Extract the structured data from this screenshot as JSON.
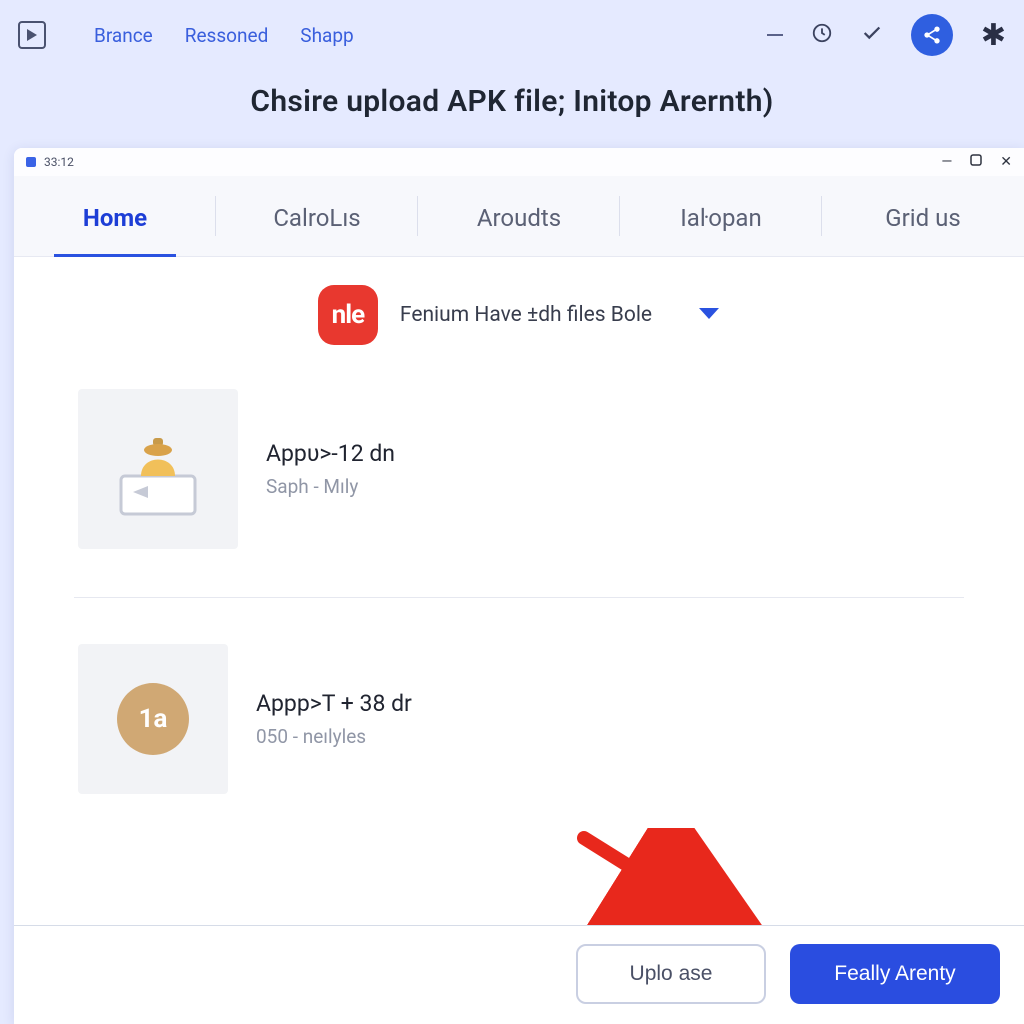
{
  "topbar": {
    "links": [
      "Brance",
      "Ressoned",
      "Shapp"
    ]
  },
  "heading": "Chsire upload APK file; Initop Arernth)",
  "inner": {
    "time": "33:12",
    "tabs": [
      {
        "label": "Home",
        "active": true
      },
      {
        "label": "CalroLıs",
        "active": false
      },
      {
        "label": "Aroudts",
        "active": false
      },
      {
        "label": "Iaŀopan",
        "active": false
      },
      {
        "label": "Grid us",
        "active": false
      }
    ],
    "app_badge": "nle",
    "dropdown_label": "Fenium Have ±dh files Bole",
    "items": [
      {
        "title": "Appυ>-12 dn",
        "sub": "Saph - Mıly"
      },
      {
        "title": "Appp>T + 38 dr",
        "sub": "050 - neılyles"
      }
    ],
    "buttons": {
      "secondary": "Uplo ase",
      "primary": "Feally Arenty"
    }
  }
}
